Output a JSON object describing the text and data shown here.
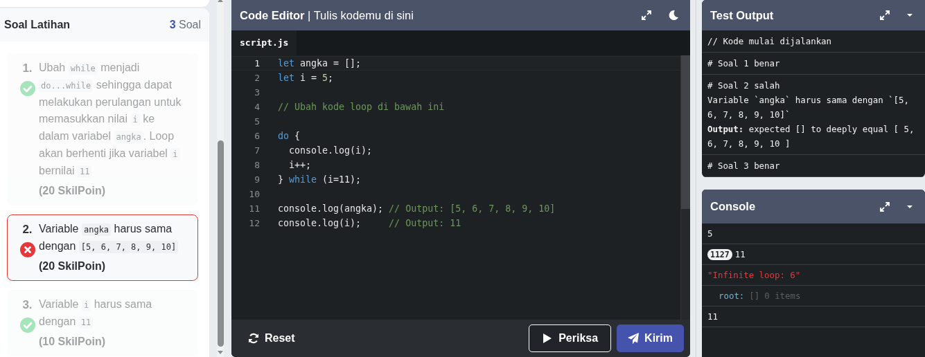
{
  "sidebar": {
    "title": "Soal Latihan",
    "count": "3",
    "count_label": "Soal",
    "questions": [
      {
        "number": "1.",
        "correct": true,
        "selected": false,
        "parts": [
          {
            "kind": "text",
            "text": "Ubah "
          },
          {
            "kind": "code",
            "text": "while"
          },
          {
            "kind": "text",
            "text": " menjadi "
          },
          {
            "kind": "code",
            "text": "do...while"
          },
          {
            "kind": "text",
            "text": " sehingga dapat melakukan perulangan untuk memasukkan nilai "
          },
          {
            "kind": "code",
            "text": "i"
          },
          {
            "kind": "text",
            "text": " ke dalam variabel "
          },
          {
            "kind": "code",
            "text": "angka"
          },
          {
            "kind": "text",
            "text": ". Loop akan berhenti jika variabel "
          },
          {
            "kind": "code",
            "text": "i"
          },
          {
            "kind": "text",
            "text": " bernilai "
          },
          {
            "kind": "code",
            "text": "11"
          }
        ],
        "points": "(20 SkilPoin)"
      },
      {
        "number": "2.",
        "correct": false,
        "selected": true,
        "parts": [
          {
            "kind": "text",
            "text": "Variable "
          },
          {
            "kind": "code",
            "text": "angka"
          },
          {
            "kind": "text",
            "text": " harus sama dengan "
          },
          {
            "kind": "code",
            "text": "[5, 6, 7, 8, 9, 10]"
          }
        ],
        "points": "(20 SkilPoin)"
      },
      {
        "number": "3.",
        "correct": true,
        "selected": false,
        "parts": [
          {
            "kind": "text",
            "text": "Variable "
          },
          {
            "kind": "code",
            "text": "i"
          },
          {
            "kind": "text",
            "text": " harus sama dengan "
          },
          {
            "kind": "code",
            "text": "11"
          }
        ],
        "points": "(10 SkilPoin)"
      }
    ]
  },
  "editor": {
    "title": "**Code Editor** | Tulis kodemu di sini",
    "file_tab": {
      "label": "script.js",
      "selected": true
    },
    "lines": [
      {
        "number": "1",
        "current": true,
        "tokens": [
          {
            "kind": "kw",
            "text": "let"
          },
          {
            "kind": "plain",
            "text": " angka = [];"
          }
        ]
      },
      {
        "number": "2",
        "current": false,
        "tokens": [
          {
            "kind": "kw",
            "text": "let"
          },
          {
            "kind": "plain",
            "text": " i = "
          },
          {
            "kind": "num",
            "text": "5"
          },
          {
            "kind": "plain",
            "text": ";"
          }
        ]
      },
      {
        "number": "3",
        "current": false
      },
      {
        "number": "4",
        "current": false,
        "tokens": [
          {
            "kind": "comment",
            "text": "// Ubah kode loop di bawah ini"
          }
        ]
      },
      {
        "number": "5",
        "current": false
      },
      {
        "number": "6",
        "current": false,
        "tokens": [
          {
            "kind": "kw",
            "text": "do"
          },
          {
            "kind": "plain",
            "text": " {"
          }
        ]
      },
      {
        "number": "7",
        "current": false,
        "tokens": [
          {
            "kind": "plain",
            "text": "  console.log(i);"
          }
        ]
      },
      {
        "number": "8",
        "current": false,
        "tokens": [
          {
            "kind": "plain",
            "text": "  i++;"
          }
        ]
      },
      {
        "number": "9",
        "current": false,
        "tokens": [
          {
            "kind": "plain",
            "text": "} "
          },
          {
            "kind": "kw",
            "text": "while"
          },
          {
            "kind": "plain",
            "text": " (i=11);"
          }
        ]
      },
      {
        "number": "10",
        "current": false
      },
      {
        "number": "11",
        "current": false,
        "tokens": [
          {
            "kind": "plain",
            "text": "console.log(angka); "
          },
          {
            "kind": "comment",
            "text": "// Output: [5, 6, 7, 8, 9, 10]"
          }
        ]
      },
      {
        "number": "12",
        "current": false,
        "tokens": [
          {
            "kind": "plain",
            "text": "console.log(i);     "
          },
          {
            "kind": "comment",
            "text": "// Output: 11"
          }
        ]
      }
    ],
    "buttons": [
      {
        "kind": "reset",
        "label": "Reset"
      },
      {
        "kind": "check",
        "label": "Periksa"
      },
      {
        "kind": "submit",
        "label": "Kirim"
      }
    ]
  },
  "test_output": {
    "title": "Test Output",
    "rows": [
      {
        "lines": [
          "// Kode mulai dijalankan"
        ]
      },
      {
        "lines": [
          "# Soal 1 benar"
        ]
      },
      {
        "lines": [
          "# Soal 2 salah",
          "Variable `angka` harus sama dengan `[5, 6, 7, 8, 9, 10]`",
          "**Output:** expected [] to deeply equal [ 5, 6, 7, 8, 9, 10 ]"
        ]
      },
      {
        "lines": [
          "# Soal 3 benar"
        ]
      }
    ]
  },
  "console": {
    "title": "Console",
    "rows": [
      {
        "kind": "value",
        "text": "5"
      },
      {
        "kind": "counted",
        "badge": "1127",
        "text": "11"
      },
      {
        "kind": "error",
        "text": "\"Infinite loop: 6\""
      },
      {
        "kind": "tree",
        "key": "root:",
        "value": "[]",
        "note": "0 items"
      },
      {
        "kind": "value",
        "text": "11"
      }
    ]
  }
}
